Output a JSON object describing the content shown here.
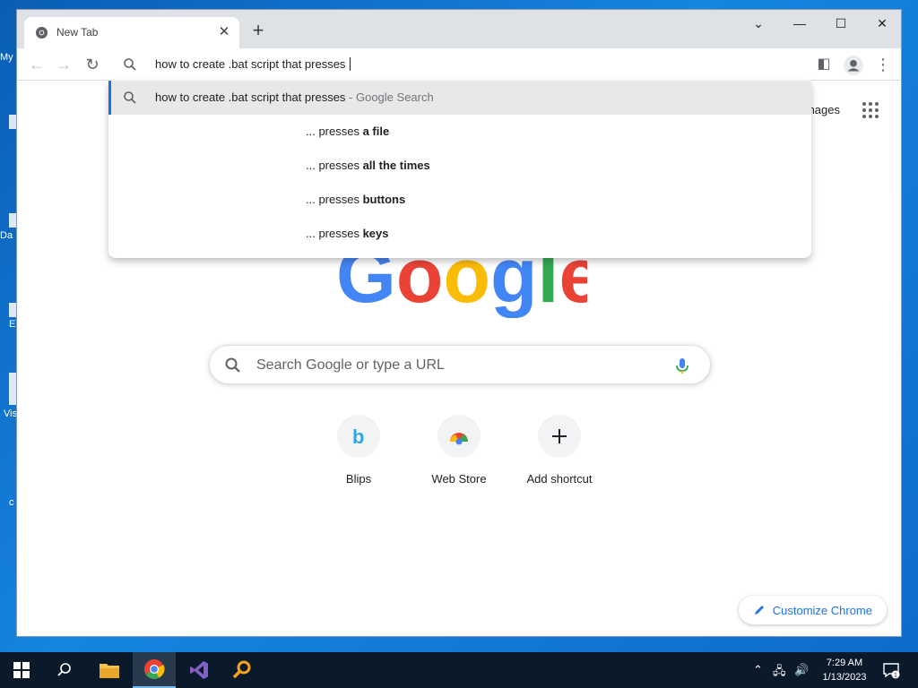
{
  "desktop": {
    "labels": [
      "My",
      "Da",
      "E",
      "Vis",
      "c"
    ]
  },
  "browser": {
    "tab_title": "New Tab",
    "omnibox_text": "how to create .bat script that presses ",
    "suggestions": [
      {
        "prefix": "how to create .bat script that presses",
        "suffix": " - Google Search"
      },
      {
        "prefix": "... presses ",
        "bold": "a file"
      },
      {
        "prefix": "... presses ",
        "bold": "all the times"
      },
      {
        "prefix": "... presses ",
        "bold": "buttons"
      },
      {
        "prefix": "... presses ",
        "bold": "keys"
      }
    ]
  },
  "newtab": {
    "images_link": "Images",
    "search_placeholder": "Search Google or type a URL",
    "shortcuts": [
      {
        "label": "Blips",
        "icon": "blips-icon"
      },
      {
        "label": "Web Store",
        "icon": "webstore-icon"
      },
      {
        "label": "Add shortcut",
        "icon": "plus-icon"
      }
    ],
    "customize_label": "Customize Chrome"
  },
  "taskbar": {
    "time": "7:29 AM",
    "date": "1/13/2023",
    "notification_count": "1"
  },
  "colors": {
    "accent": "#1a73e8",
    "google_blue": "#4285f4",
    "google_red": "#ea4335",
    "google_yellow": "#fbbc05",
    "google_green": "#34a853"
  }
}
